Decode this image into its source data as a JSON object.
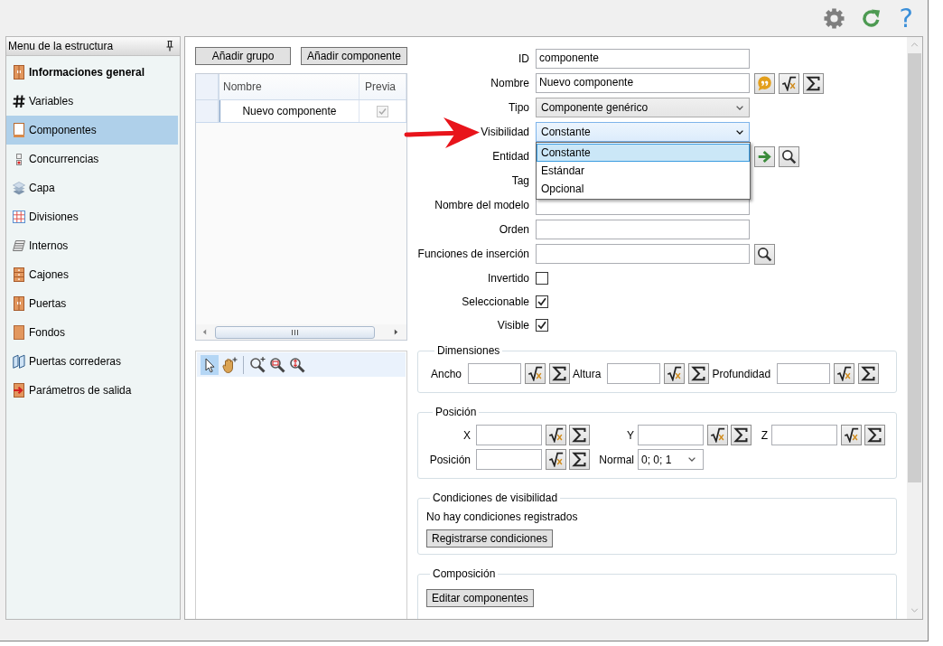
{
  "top_bar": {
    "help_button": "?"
  },
  "sidebar": {
    "title": "Menu de la estructura",
    "items": [
      {
        "label": "Informaciones general",
        "bold": true,
        "selected": false
      },
      {
        "label": "Variables",
        "bold": false,
        "selected": false
      },
      {
        "label": "Componentes",
        "bold": false,
        "selected": true
      },
      {
        "label": "Concurrencias",
        "bold": false,
        "selected": false
      },
      {
        "label": "Capa",
        "bold": false,
        "selected": false
      },
      {
        "label": "Divisiones",
        "bold": false,
        "selected": false
      },
      {
        "label": "Internos",
        "bold": false,
        "selected": false
      },
      {
        "label": "Cajones",
        "bold": false,
        "selected": false
      },
      {
        "label": "Puertas",
        "bold": false,
        "selected": false
      },
      {
        "label": "Fondos",
        "bold": false,
        "selected": false
      },
      {
        "label": "Puertas correderas",
        "bold": false,
        "selected": false
      },
      {
        "label": "Parámetros de salida",
        "bold": false,
        "selected": false
      }
    ]
  },
  "component_list": {
    "buttons": [
      "Añadir grupo",
      "Añadir componente"
    ],
    "columns": [
      "Nombre",
      "Previa"
    ],
    "rows": [
      {
        "name": "Nuevo componente",
        "preview": {
          "checked": true,
          "disabled": true
        }
      }
    ]
  },
  "viewer_tools": [
    {
      "selected": true
    },
    {
      "selected": false
    },
    {
      "selected": false
    },
    {
      "selected": false
    },
    {
      "selected": false
    }
  ],
  "form": {
    "fields": [
      {
        "kind": "text",
        "label": "ID",
        "value": "componente"
      },
      {
        "kind": "text",
        "label": "Nombre",
        "value": "Nuevo componente"
      },
      {
        "kind": "dropdown",
        "label": "Tipo",
        "value": "Componente genérico",
        "expanded": false
      },
      {
        "kind": "dropdown",
        "label": "Visibilidad",
        "value": "Constante",
        "expanded": true,
        "options": [
          {
            "label": "Constante",
            "selected": true
          },
          {
            "label": "Estándar",
            "selected": false
          },
          {
            "label": "Opcional",
            "selected": false
          }
        ]
      },
      {
        "kind": "text",
        "label": "Entidad"
      },
      {
        "kind": "text",
        "label": "Tag"
      },
      {
        "kind": "text",
        "label": "Nombre del modelo"
      },
      {
        "kind": "text",
        "label": "Orden"
      },
      {
        "kind": "text",
        "label": "Funciones de inserción"
      },
      {
        "kind": "checkbox",
        "label": "Invertido",
        "checked": false
      },
      {
        "kind": "checkbox",
        "label": "Seleccionable",
        "checked": true
      },
      {
        "kind": "checkbox",
        "label": "Visible",
        "checked": true
      }
    ]
  },
  "dimensions": {
    "title": "Dimensiones",
    "fields": [
      {
        "kind": "formula",
        "label": "Ancho"
      },
      {
        "kind": "formula",
        "label": "Altura"
      },
      {
        "kind": "formula",
        "label": "Profundidad"
      }
    ]
  },
  "position": {
    "title": "Posición",
    "rows": [
      [
        {
          "kind": "formula",
          "label": "X"
        },
        {
          "kind": "formula",
          "label": "Y"
        },
        {
          "kind": "formula",
          "label": "Z"
        }
      ],
      [
        {
          "kind": "formula",
          "label": "Posición"
        },
        {
          "kind": "dropdown",
          "label": "Normal",
          "value": "0; 0; 1"
        }
      ]
    ]
  },
  "visibility_conditions": {
    "title": "Condiciones de visibilidad",
    "message": "No hay condiciones registrados",
    "button": "Registrarse condiciones"
  },
  "composition": {
    "title": "Composición",
    "button": "Editar componentes"
  }
}
